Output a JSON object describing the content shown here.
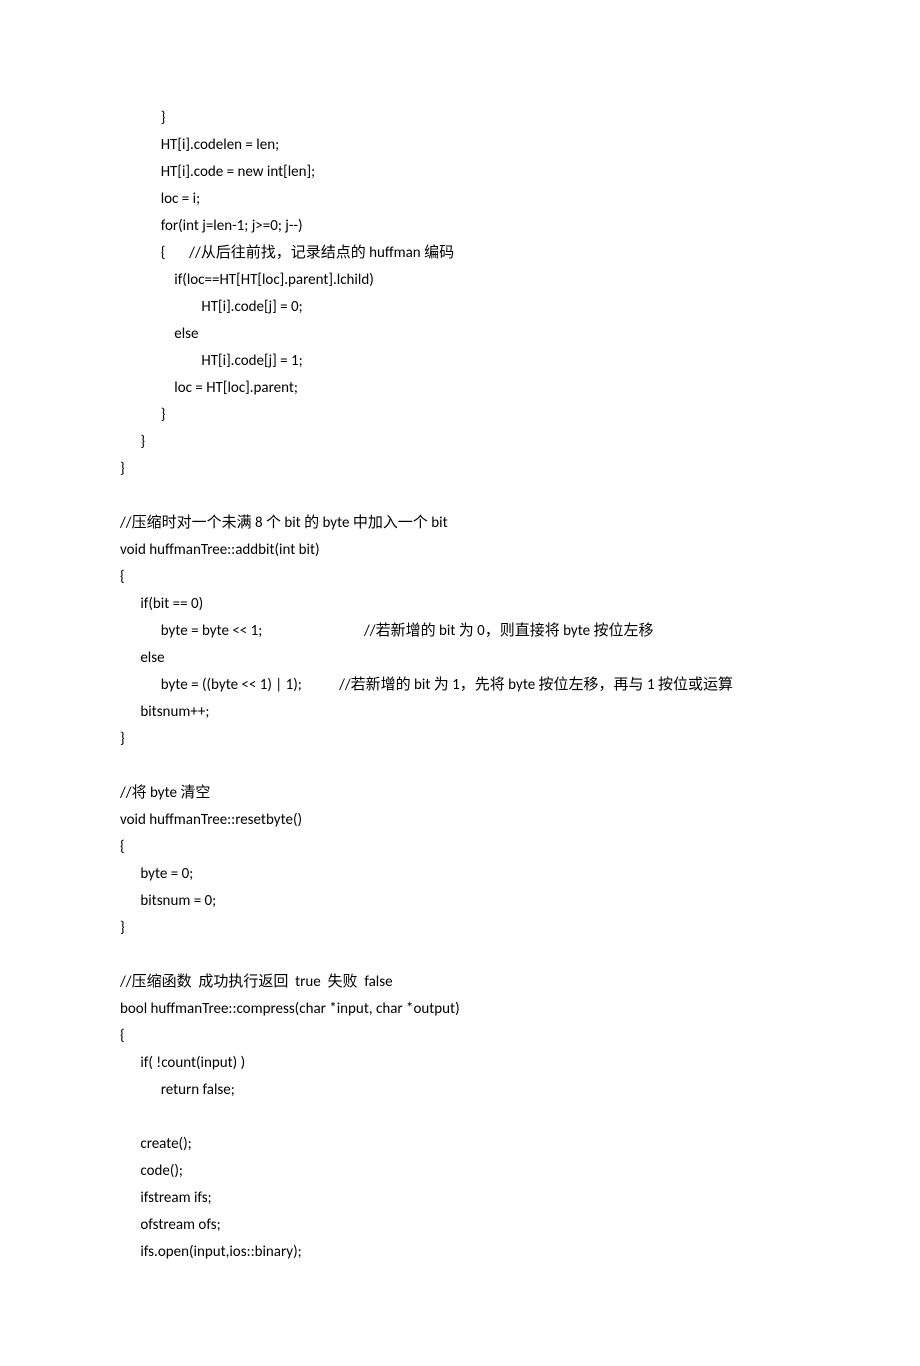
{
  "lines": [
    "            }",
    "            HT[i].codelen = len;",
    "            HT[i].code = new int[len];",
    "            loc = i;",
    "            for(int j=len-1; j>=0; j--)",
    "            {       //从后往前找，记录结点的 huffman 编码",
    "                if(loc==HT[HT[loc].parent].lchild)",
    "                        HT[i].code[j] = 0;",
    "                else",
    "                        HT[i].code[j] = 1;",
    "                loc = HT[loc].parent;",
    "            }",
    "      }",
    "}",
    "",
    "//压缩时对一个未满 8 个 bit 的 byte 中加入一个 bit",
    "void huffmanTree::addbit(int bit)",
    "{",
    "      if(bit == 0)",
    "            byte = byte << 1;                              //若新增的 bit 为 0，则直接将 byte 按位左移",
    "      else",
    "            byte = ((byte << 1) | 1);           //若新增的 bit 为 1，先将 byte 按位左移，再与 1 按位或运算",
    "      bitsnum++;",
    "}",
    "",
    "//将 byte 清空",
    "void huffmanTree::resetbyte()",
    "{",
    "      byte = 0;",
    "      bitsnum = 0;",
    "}",
    "",
    "//压缩函数  成功执行返回  true  失败  false",
    "bool huffmanTree::compress(char *input, char *output)",
    "{",
    "      if( !count(input) )",
    "            return false;",
    "",
    "      create();",
    "      code();",
    "      ifstream ifs;",
    "      ofstream ofs;",
    "      ifs.open(input,ios::binary);"
  ]
}
